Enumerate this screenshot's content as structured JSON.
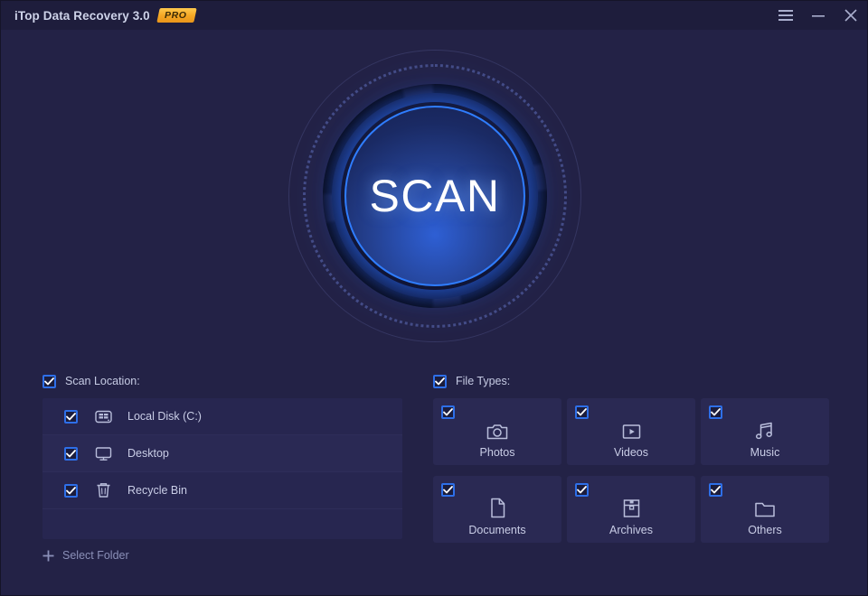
{
  "window": {
    "title": "iTop Data Recovery 3.0",
    "edition_badge": "PRO",
    "controls": [
      {
        "name": "menu-button",
        "icon": "hamburger-menu-icon"
      },
      {
        "name": "minimize-button",
        "icon": "minimize-icon"
      },
      {
        "name": "close-button",
        "icon": "close-icon"
      }
    ]
  },
  "scan": {
    "button_label": "SCAN",
    "accent_color": "#2f7dff",
    "glow_color": "#2a6efa"
  },
  "scan_location": {
    "header_label": "Scan Location:",
    "header_checked": true,
    "items": [
      {
        "label": "Local Disk (C:)",
        "icon": "hard-disk-icon",
        "checked": true
      },
      {
        "label": "Desktop",
        "icon": "monitor-icon",
        "checked": true
      },
      {
        "label": "Recycle Bin",
        "icon": "trash-icon",
        "checked": true
      }
    ],
    "select_folder_label": "Select Folder",
    "select_folder_icon": "plus-icon"
  },
  "file_types": {
    "header_label": "File Types:",
    "header_checked": true,
    "items": [
      {
        "label": "Photos",
        "icon": "camera-icon",
        "checked": true
      },
      {
        "label": "Videos",
        "icon": "video-icon",
        "checked": true
      },
      {
        "label": "Music",
        "icon": "music-note-icon",
        "checked": true
      },
      {
        "label": "Documents",
        "icon": "document-icon",
        "checked": true
      },
      {
        "label": "Archives",
        "icon": "archive-box-icon",
        "checked": true
      },
      {
        "label": "Others",
        "icon": "folder-icon",
        "checked": true
      }
    ]
  },
  "theme": {
    "background": "#232246",
    "titlebar": "#1e1d3c",
    "panel": "#272650",
    "tile": "#2a2953",
    "text_primary": "#c9cde6",
    "text_muted": "#8b90b8",
    "badge_color": "#f5a623",
    "checkbox_border": "#2e6fe8"
  }
}
